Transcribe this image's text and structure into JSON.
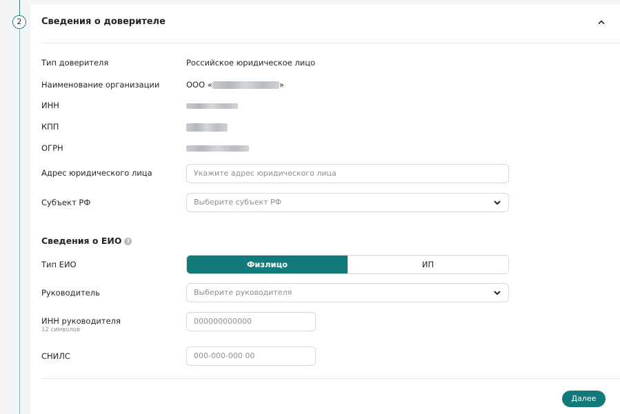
{
  "stepper": {
    "step_number": "2"
  },
  "section": {
    "title": "Сведения о доверителе"
  },
  "principal": {
    "type_label": "Тип доверителя",
    "type_value": "Российское юридическое лицо",
    "org_name_label": "Наименование организации",
    "org_name_prefix": "ООО «",
    "org_name_suffix": "»",
    "inn_label": "ИНН",
    "kpp_label": "КПП",
    "ogrn_label": "ОГРН",
    "address_label": "Адрес юридического лица",
    "address_placeholder": "Укажите адрес юридического лица",
    "region_label": "Субъект РФ",
    "region_placeholder": "Выберите субъект РФ"
  },
  "eio": {
    "title": "Сведения о ЕИО",
    "help_icon": "question-circle-icon",
    "type_label": "Тип ЕИО",
    "type_options": [
      "Физлицо",
      "ИП"
    ],
    "type_selected": "Физлицо",
    "head_label": "Руководитель",
    "head_placeholder": "Выберите руководителя",
    "head_inn_label": "ИНН руководителя",
    "head_inn_hint": "12 символов",
    "head_inn_placeholder": "000000000000",
    "snils_label": "СНИЛС",
    "snils_placeholder": "000-000-000 00"
  },
  "actions": {
    "next_label": "Далее"
  },
  "colors": {
    "accent": "#127a7b",
    "stepper": "#2b7f80",
    "background": "#f4f5f7",
    "card": "#ffffff",
    "border": "#d5d8dc",
    "placeholder": "#8a8f96"
  }
}
